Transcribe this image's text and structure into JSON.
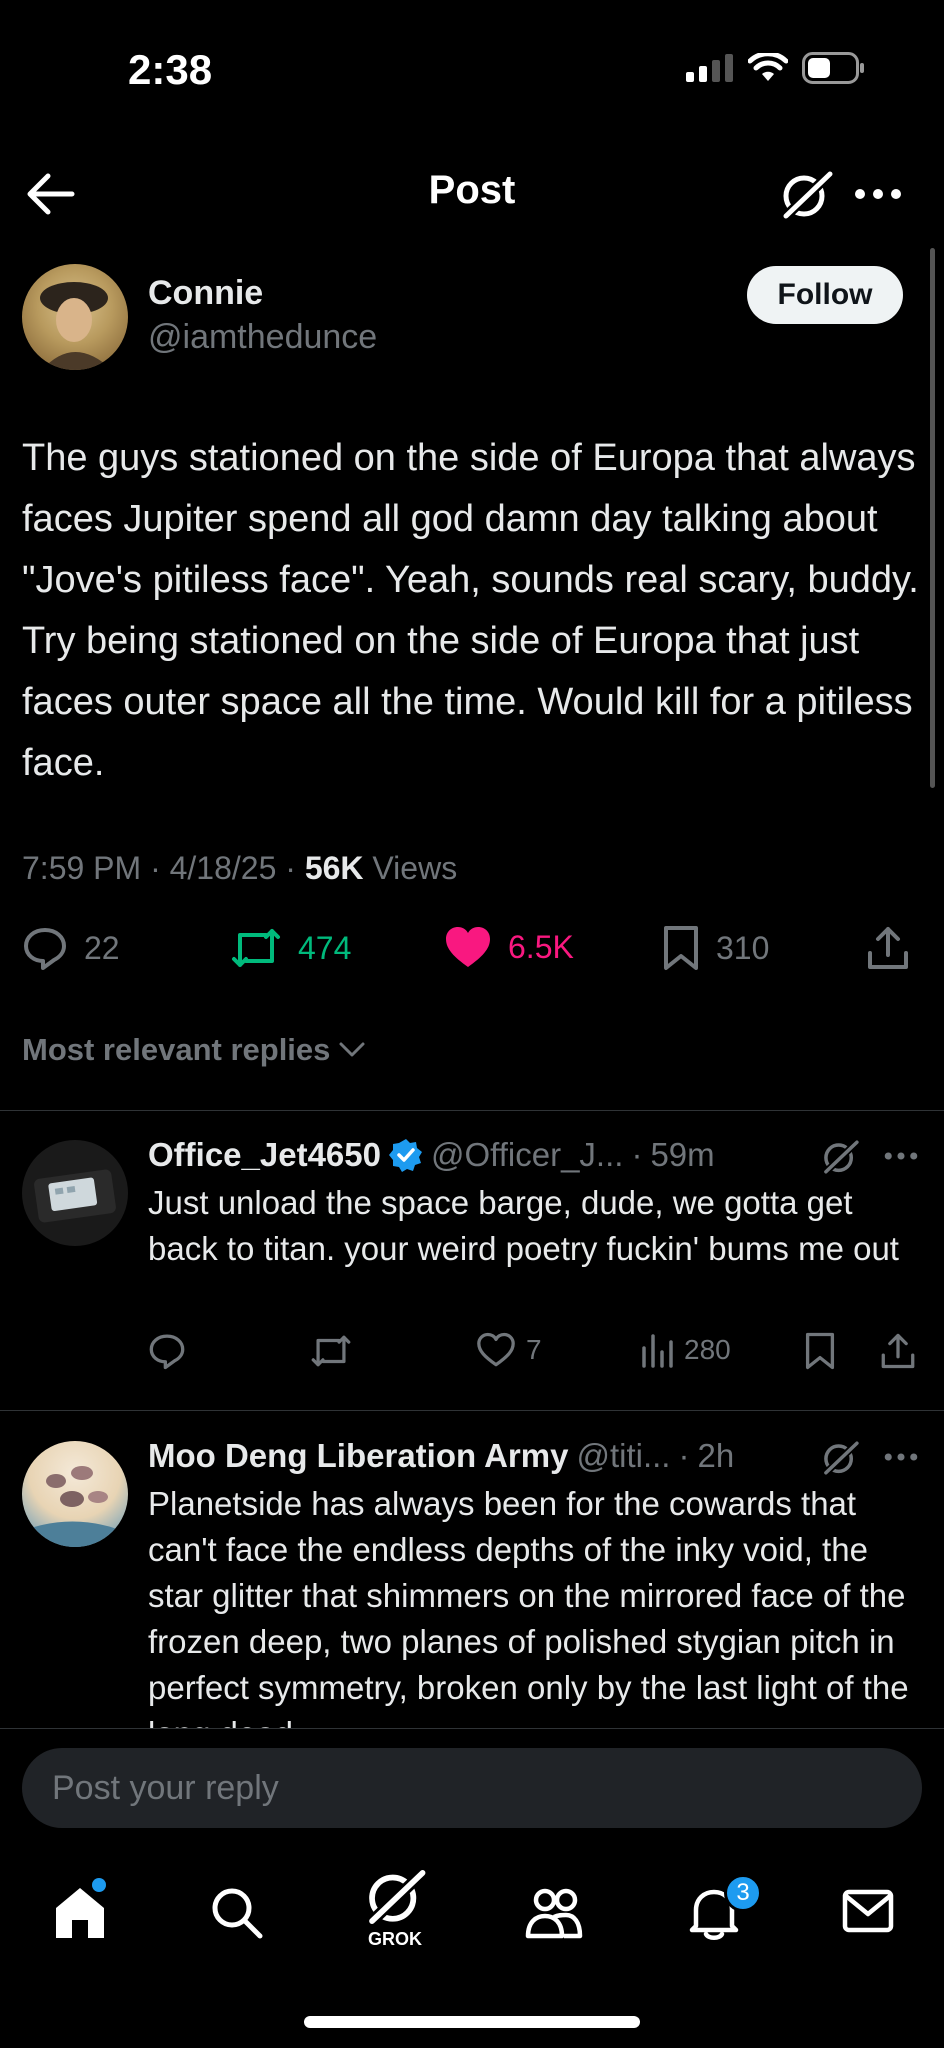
{
  "status": {
    "time": "2:38"
  },
  "header": {
    "title": "Post"
  },
  "post": {
    "author_name": "Connie",
    "author_handle": "@iamthedunce",
    "follow_label": "Follow",
    "text": "The guys stationed on the side of Europa that always faces Jupiter spend all god damn day talking about \"Jove's pitiless face\". Yeah, sounds real scary, buddy. Try being stationed on the side of Europa that just faces outer space all the time. Would kill for a pitiless face.",
    "time": "7:59 PM",
    "date": "4/18/25",
    "views_count": "56K",
    "views_label": "Views",
    "replies": "22",
    "reposts": "474",
    "likes": "6.5K",
    "bookmarks": "310"
  },
  "replies_filter": {
    "label": "Most relevant replies"
  },
  "replies": [
    {
      "name": "Office_Jet4650",
      "handle": "@Officer_J...",
      "time": "59m",
      "text": "Just unload the space barge, dude, we gotta get back to titan. your weird poetry fuckin' bums me out",
      "likes": "7",
      "views": "280"
    },
    {
      "name": "Moo Deng Liberation Army",
      "handle": "@titi...",
      "time": "2h",
      "text": "Planetside has always been for the cowards that can't face the endless depths of the inky void, the star glitter that shimmers on the mirrored face of the frozen deep, two planes of polished stygian pitch in perfect symmetry, broken only by the last light of the long dead"
    }
  ],
  "compose": {
    "placeholder": "Post your reply"
  },
  "tabbar": {
    "grok_label": "GROK",
    "notifications_badge": "3"
  },
  "colors": {
    "accent": "#1d9bf0",
    "repost": "#00ba7c",
    "like": "#f91880",
    "muted": "#71767b"
  }
}
